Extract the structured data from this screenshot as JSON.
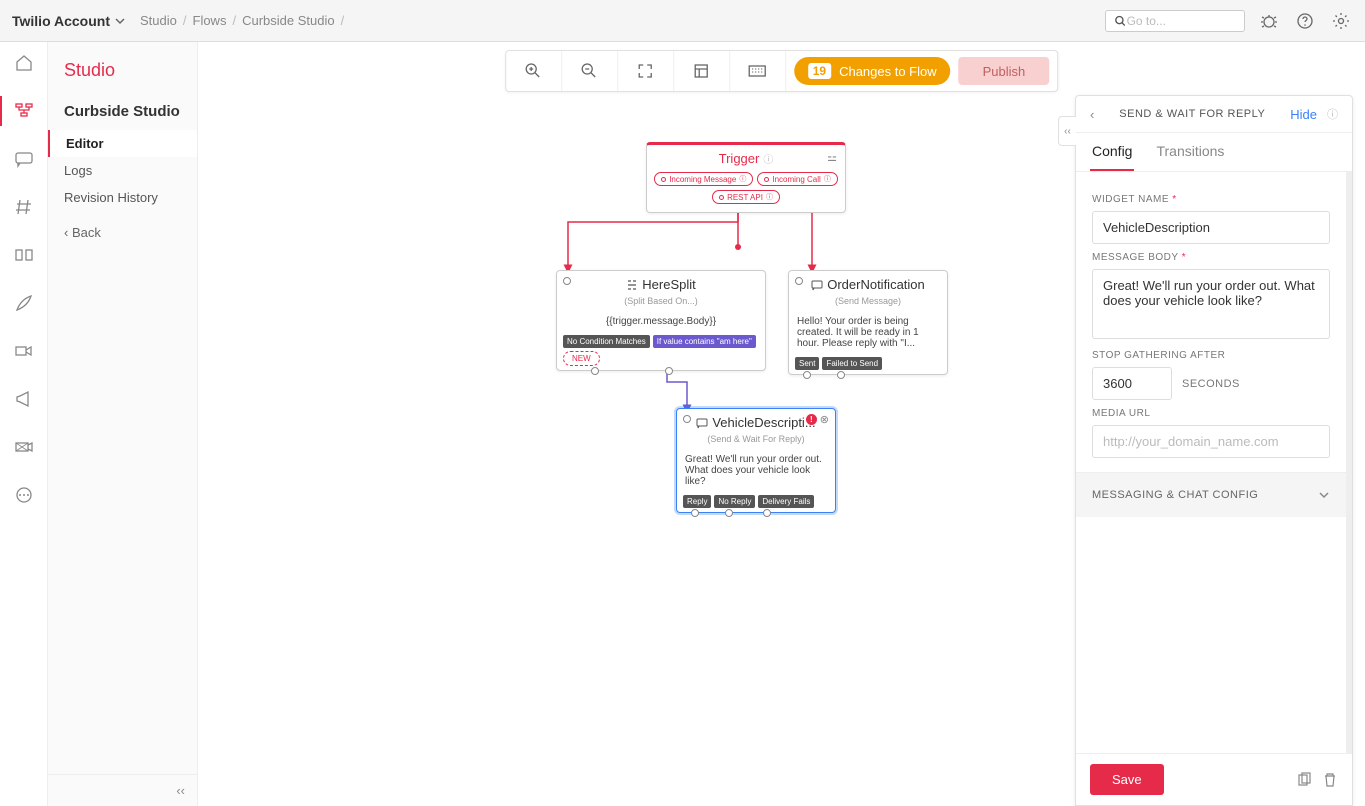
{
  "topbar": {
    "account": "Twilio Account",
    "breadcrumbs": [
      "Studio",
      "Flows",
      "Curbside Studio"
    ],
    "search_placeholder": "Go to..."
  },
  "sidebar": {
    "product": "Studio",
    "flow": "Curbside Studio",
    "items": [
      "Editor",
      "Logs",
      "Revision History"
    ],
    "back": "Back"
  },
  "toolbar": {
    "changes_count": "19",
    "changes_label": "Changes to Flow",
    "publish": "Publish"
  },
  "nodes": {
    "trigger": {
      "title": "Trigger",
      "pills": [
        "Incoming Message",
        "Incoming Call",
        "REST API"
      ]
    },
    "heresplit": {
      "title": "HereSplit",
      "subtitle": "(Split Based On...)",
      "body": "{{trigger.message.Body}}",
      "tags": {
        "nomatch": "No Condition Matches",
        "cond": "If value contains \"am here\"",
        "newlabel": "NEW"
      }
    },
    "order": {
      "title": "OrderNotification",
      "subtitle": "(Send Message)",
      "body": "Hello! Your order is being created. It will be ready in 1 hour. Please reply with \"I...",
      "tags": {
        "sent": "Sent",
        "failed": "Failed to Send"
      }
    },
    "vehicle": {
      "title": "VehicleDescripti...",
      "subtitle": "(Send & Wait For Reply)",
      "body": "Great! We'll run your order out. What does your vehicle look like?",
      "tags": {
        "reply": "Reply",
        "noreply": "No Reply",
        "dfail": "Delivery Fails"
      }
    }
  },
  "panel": {
    "title": "SEND & WAIT FOR REPLY",
    "hide": "Hide",
    "tabs": {
      "config": "Config",
      "transitions": "Transitions"
    },
    "labels": {
      "widget_name": "WIDGET NAME",
      "message_body": "MESSAGE BODY",
      "stop_gathering": "STOP GATHERING AFTER",
      "seconds": "SECONDS",
      "media_url": "MEDIA URL",
      "messaging": "MESSAGING & CHAT CONFIG"
    },
    "values": {
      "widget_name": "VehicleDescription",
      "message_body": "Great! We'll run your order out. What does your vehicle look like?",
      "stop_gathering": "3600",
      "media_placeholder": "http://your_domain_name.com"
    },
    "save": "Save"
  }
}
